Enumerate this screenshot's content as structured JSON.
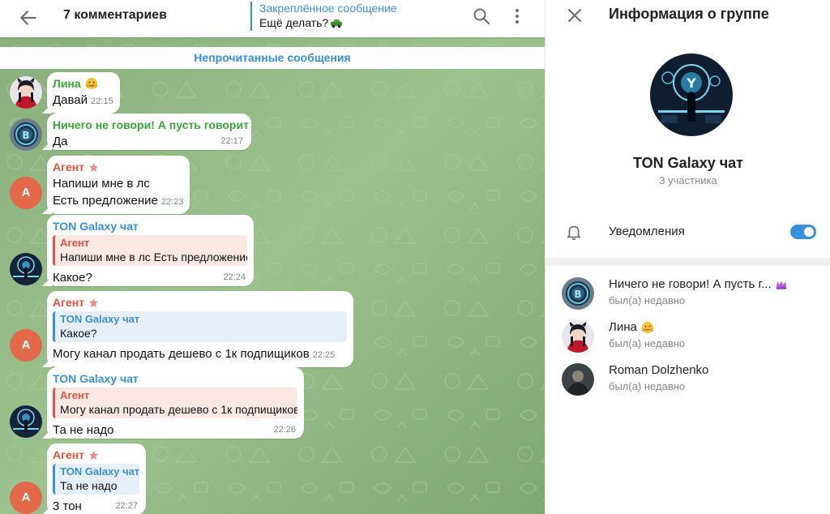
{
  "chat": {
    "header": {
      "title": "7 комментариев",
      "pinned_title": "Закреплённое сообщение",
      "pinned_text": "Ещё делать?"
    },
    "unread_label": "Непрочитанные сообщения",
    "messages": [
      {
        "sender": "Лина",
        "text": "Давай",
        "time": "22:15"
      },
      {
        "sender": "Ничего не говори! А пусть говорит",
        "text": "Да",
        "time": "22:17"
      },
      {
        "sender": "Агент",
        "lines": [
          "Напиши мне в лс",
          "Есть предложение"
        ],
        "time": "22:23",
        "avatar_letter": "A"
      },
      {
        "sender": "TON Galaxy чат",
        "reply_name": "Агент",
        "reply_text": "Напиши мне в лс Есть предложение",
        "text": "Какое?",
        "time": "22:24"
      },
      {
        "sender": "Агент",
        "reply_name": "TON Galaxy чат",
        "reply_text": "Какое?",
        "text": "Могу канал продать дешево с 1к подпищиков",
        "time": "22:25",
        "avatar_letter": "A"
      },
      {
        "sender": "TON Galaxy чат",
        "reply_name": "Агент",
        "reply_text": "Могу канал продать дешево с 1к подпищиков",
        "text": "Та не надо",
        "time": "22:26"
      },
      {
        "sender": "Агент",
        "reply_name": "TON Galaxy чат",
        "reply_text": "Та не надо",
        "text": "3 тон",
        "time": "22:27",
        "avatar_letter": "A"
      }
    ]
  },
  "info": {
    "title": "Информация о группе",
    "group_name": "TON Galaxy чат",
    "members_count": "3 участника",
    "notifications_label": "Уведомления",
    "notifications_on": true,
    "members": [
      {
        "name": "Ничего не говори! А пусть г...",
        "status": "был(а) недавно"
      },
      {
        "name": "Лина",
        "status": "был(а) недавно"
      },
      {
        "name": "Roman Dolzhenko",
        "status": "был(а) недавно"
      }
    ]
  },
  "colors": {
    "accent": "#3a8fdc",
    "sender_green": "#3aa63a",
    "sender_red": "#e4543f",
    "chat_background": "#8fb584",
    "avatar_orange": "#e26a4a"
  }
}
